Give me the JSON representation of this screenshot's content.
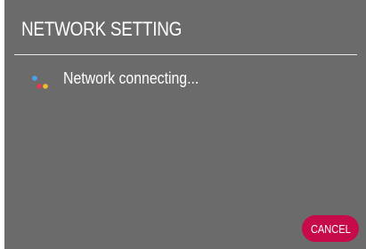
{
  "dialog": {
    "title": "NETWORK SETTING",
    "status_text": "Network connecting...",
    "spinner_icon": "loading-dots-icon",
    "cancel_label": "CANCEL"
  },
  "colors": {
    "panel_background": "#6b6b6b",
    "text": "#ffffff",
    "divider": "#e8e8e8",
    "cancel_button": "#c70a4a",
    "spinner_dots": [
      "#4aa3f0",
      "#f5b82e",
      "#e8384f"
    ]
  }
}
